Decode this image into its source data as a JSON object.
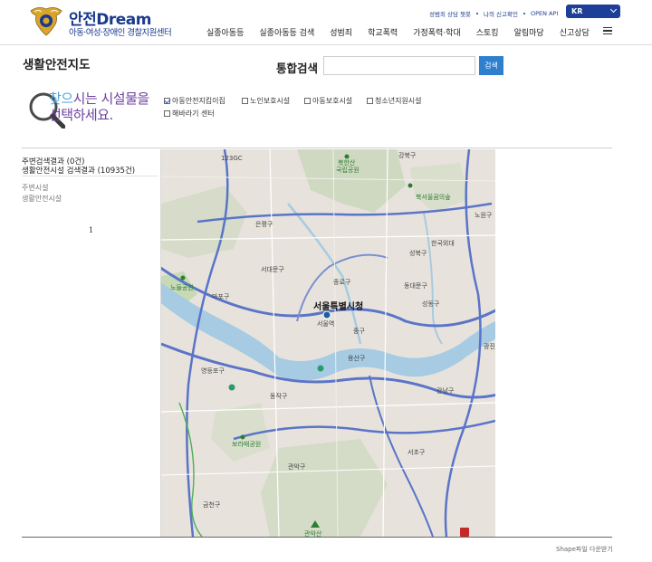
{
  "header": {
    "brand_main": "안전",
    "brand_dream": "Dream",
    "brand_sub": "아동·여성·장애인 경찰지원센터",
    "util_links": [
      "성범죄 상담 챗봇",
      "나의 신고확인",
      "OPEN API"
    ],
    "language": "KR",
    "nav": [
      "실종아동등",
      "실종아동등 검색",
      "성범죄",
      "학교폭력",
      "가정폭력·학대",
      "스토킹",
      "알림마당",
      "신고상담"
    ]
  },
  "page": {
    "title": "생활안전지도",
    "search_label": "통합검색",
    "search_value": "",
    "search_button": "검색"
  },
  "prompt": {
    "line1_highlight": "찾으",
    "line1_rest": "시는 시설물을",
    "line2": "선택하세요."
  },
  "filters": [
    {
      "label": "아동안전지킴이집",
      "checked": true
    },
    {
      "label": "노인보호시설",
      "checked": false
    },
    {
      "label": "아동보호시설",
      "checked": false
    },
    {
      "label": "청소년지원시설",
      "checked": false
    },
    {
      "label": "해바라기 센터",
      "checked": false
    }
  ],
  "sidebar": {
    "nearby_result": "주변검색결과 (0건)",
    "facility_result": "생활안전시설 검색결과 (10935건)",
    "category_nearby": "주변시설",
    "category_safety": "생활안전시설",
    "page_number": "1"
  },
  "map": {
    "labels": [
      "북한산",
      "국립공원",
      "강북구",
      "123GC",
      "은평구",
      "성북구",
      "노원구",
      "북서울꿈의숲",
      "한국외대",
      "마포구",
      "서대문구",
      "종로구",
      "중구",
      "서울특별시청",
      "서울역",
      "동대문구",
      "광진구",
      "용산구",
      "영등포구",
      "동작구",
      "관악구",
      "강남구",
      "서초구",
      "성동구",
      "노들공원",
      "보라매공원",
      "관악산",
      "금천구"
    ]
  },
  "colors": {
    "brand": "#1a3a8c",
    "accent_button": "#2f7fcf",
    "river": "#a6cbe3",
    "road": "#5a74c8"
  },
  "footer": {
    "shape_download": "Shape파일 다운받기"
  }
}
